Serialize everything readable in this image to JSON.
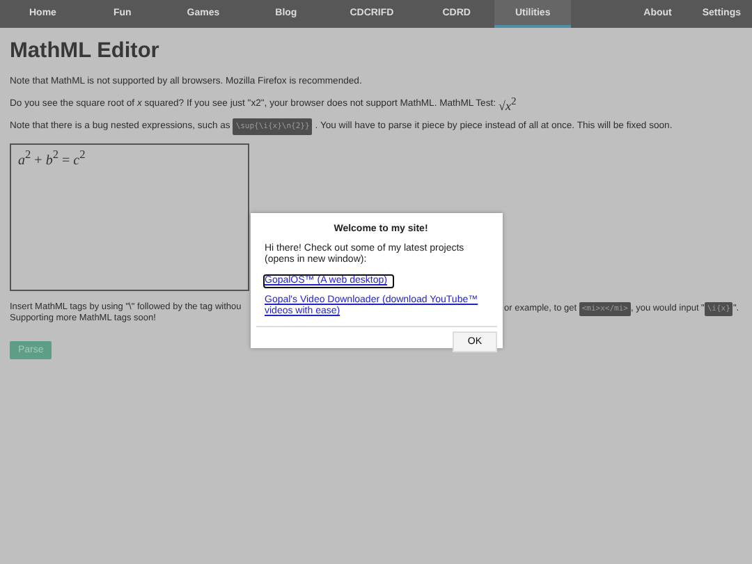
{
  "nav": {
    "left": [
      {
        "label": "Home",
        "selected": false
      },
      {
        "label": "Fun",
        "selected": false
      },
      {
        "label": "Games",
        "selected": false
      },
      {
        "label": "Blog",
        "selected": false
      },
      {
        "label": "CDCRIFD",
        "selected": false
      },
      {
        "label": "CDRD",
        "selected": false
      },
      {
        "label": "Utilities",
        "selected": true
      }
    ],
    "right": [
      {
        "label": "About",
        "selected": false
      },
      {
        "label": "Settings",
        "selected": false
      }
    ]
  },
  "title": "MathML Editor",
  "notes": [
    {
      "text": "Note that MathML is not supported by all browsers. Mozilla Firefox is recommended."
    },
    {
      "text": "Do you see the square root of *x* squared? If you see just \"x2\", your browser does not support MathML. MathML Test:",
      "math": "√*x*$^{2}$"
    },
    {
      "text": "Note that there is a bug nested expressions, such as",
      "code": "\\sup{\\i{x}\\n{2}}",
      "after": ". You will have to parse it piece by piece instead of all at once. This will be fixed soon."
    }
  ],
  "editor": {
    "value": "*a*$^{2}$ + *b*$^{2}$ = *c*$^{2}$"
  },
  "help": {
    "left_line_1": "Insert MathML tags by using \"\\\" followed by the tag withou",
    "left_line_2": "Supporting more MathML tags soon!",
    "right_before": "or example, to get",
    "right_code_1": "<mi>x</mi>",
    "right_middle": ", you would input \"",
    "right_code_2": "\\i{x}",
    "right_after": "\"."
  },
  "parse_button": {
    "label": "Parse",
    "disabled": true
  },
  "dialog": {
    "title": "Welcome to my site!",
    "message": "Hi there! Check out some of my latest projects (opens in new window):",
    "links": [
      {
        "label": "GopalOS™ (A web desktop)",
        "focused": true
      },
      {
        "label": "Gopal's Video Downloader (download YouTube™ videos with ease)",
        "focused": false
      }
    ],
    "ok": "OK"
  }
}
